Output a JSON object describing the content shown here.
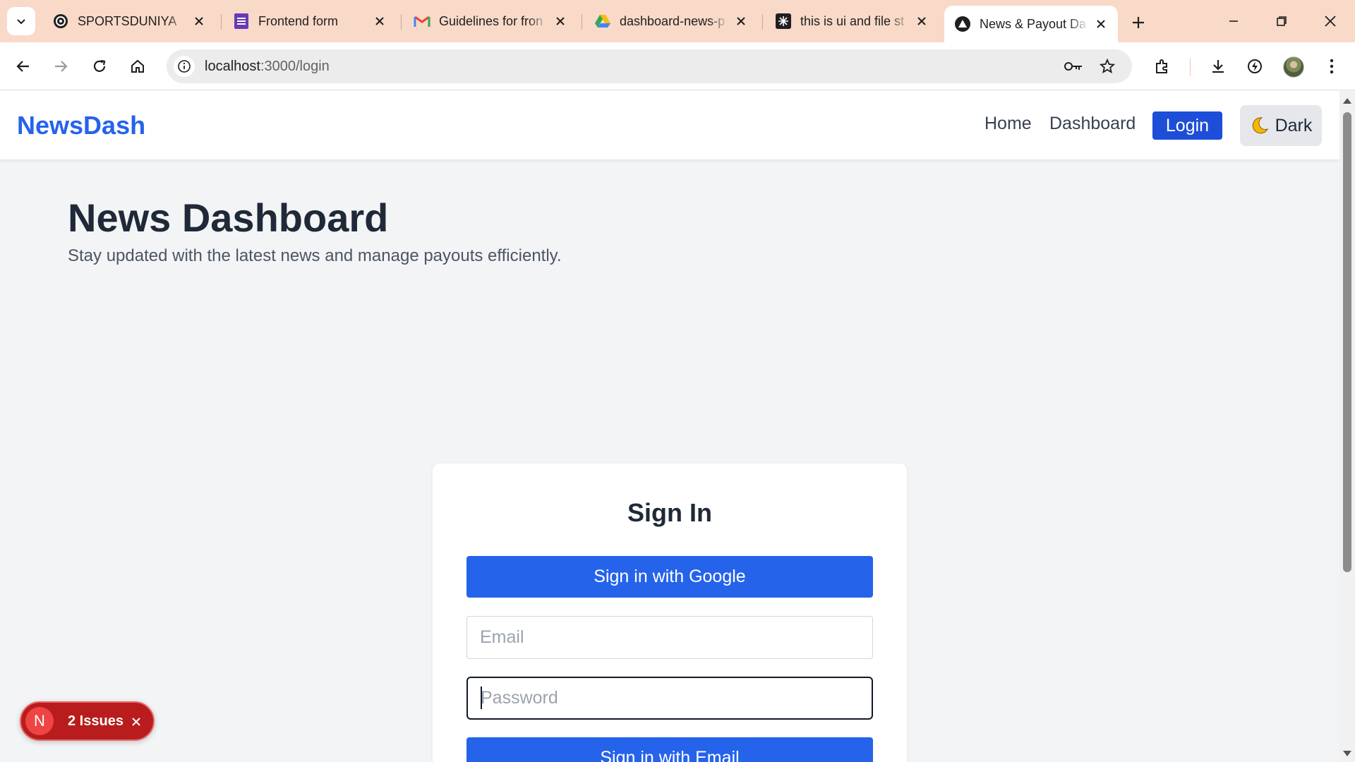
{
  "browser": {
    "tabs": [
      {
        "title": "SPORTSDUNIYA",
        "icon": "sportsduniya-icon"
      },
      {
        "title": "Frontend form",
        "icon": "google-forms-icon"
      },
      {
        "title": "Guidelines for fron",
        "icon": "gmail-icon"
      },
      {
        "title": "dashboard-news-p",
        "icon": "google-drive-icon"
      },
      {
        "title": "this is ui and file st",
        "icon": "chatgpt-icon"
      },
      {
        "title": "News & Payout Da",
        "icon": "app-favicon-icon",
        "active": true
      }
    ],
    "address": {
      "host": "localhost",
      "path": ":3000/login"
    },
    "colors": {
      "tabstrip": "#f9d9c8",
      "toolbar": "#ffffff",
      "omnibox": "#ececec"
    }
  },
  "app": {
    "brand": "NewsDash",
    "nav": {
      "home": "Home",
      "dashboard": "Dashboard",
      "login": "Login",
      "theme": "Dark"
    },
    "hero": {
      "title": "News Dashboard",
      "subtitle": "Stay updated with the latest news and manage payouts efficiently."
    },
    "signin": {
      "title": "Sign In",
      "google_button": "Sign in with Google",
      "email_placeholder": "Email",
      "email_value": "",
      "password_placeholder": "Password",
      "password_value": "",
      "email_button": "Sign in with Email"
    },
    "issues": {
      "badge_letter": "N",
      "label": "2 Issues"
    },
    "colors": {
      "primary": "#2563eb",
      "login_button": "#1d4ed8",
      "issues": "#b91c1c",
      "background": "#f3f4f6"
    }
  }
}
